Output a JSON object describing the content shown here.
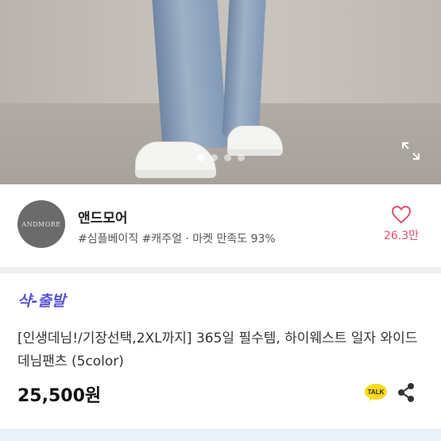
{
  "shop": {
    "logo_text": "ANDMORE",
    "name": "앤드모어",
    "tags": "#심플베이직 #캐주얼 · 마켓 만족도 93%",
    "like_count": "26.3만"
  },
  "hero": {
    "dots_total": 4,
    "active_dot": 1
  },
  "product": {
    "badge": "샥-출발",
    "title": "[인생데님!/기장선택,2XL까지] 365일 필수템, 하이웨스트 일자 와이드 데님팬츠 (5color)",
    "price": "25,500원",
    "talk_label": "TALK"
  },
  "colors": {
    "accent": "#5a52d6",
    "like": "#e0506b",
    "talk_yellow": "#f6dc1b"
  }
}
